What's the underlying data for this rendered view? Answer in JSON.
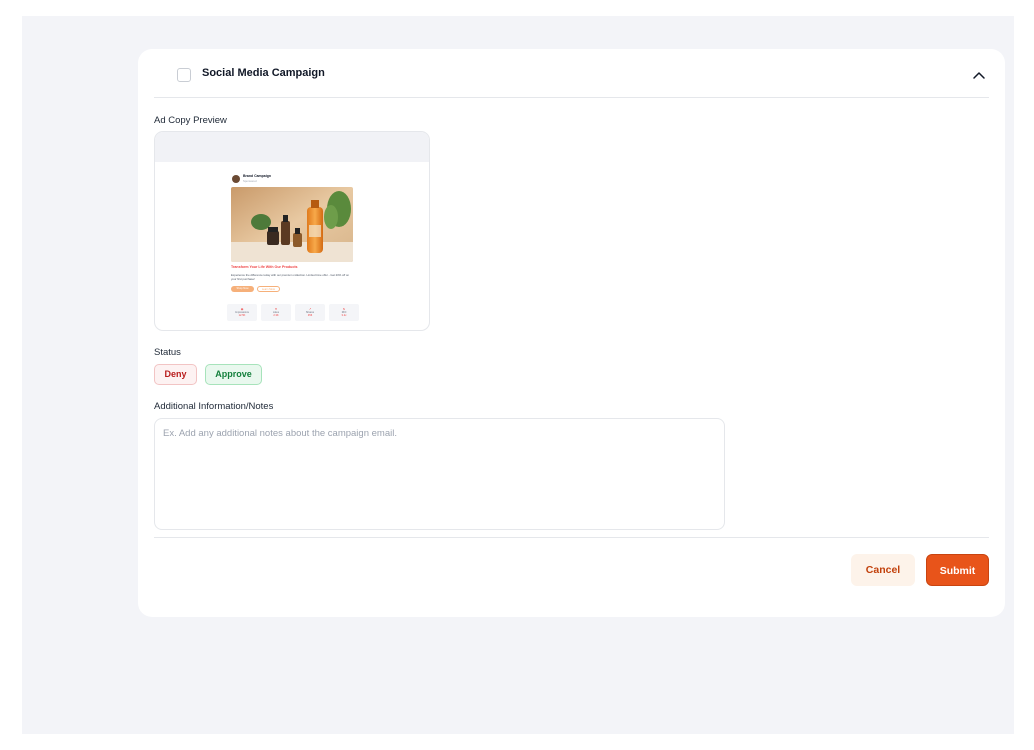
{
  "section": {
    "title": "Social Media Campaign",
    "collapse_icon": "chevron-up-icon"
  },
  "preview": {
    "label": "Ad Copy Preview",
    "post": {
      "brand": "Brand Campaign",
      "sponsored": "Sponsored",
      "headline": "Transform Your Life With Our Products",
      "body": "Experience the difference today with our premium collection. Limited time offer - Get 20% off on your first purchase!",
      "primary_cta": "Shop Now",
      "secondary_cta": "Learn More",
      "stats": [
        {
          "icon": "eye-icon",
          "label": "Impressions",
          "value": "12.5K"
        },
        {
          "icon": "thumb-up-icon",
          "label": "Likes",
          "value": "2.3K"
        },
        {
          "icon": "share-icon",
          "label": "Shares",
          "value": "456"
        },
        {
          "icon": "dollar-icon",
          "label": "ROI",
          "value": "3.2x"
        }
      ]
    }
  },
  "status": {
    "label": "Status",
    "deny_label": "Deny",
    "approve_label": "Approve"
  },
  "notes": {
    "label": "Additional Information/Notes",
    "placeholder": "Ex. Add any additional notes about the campaign email.",
    "value": ""
  },
  "actions": {
    "cancel_label": "Cancel",
    "submit_label": "Submit"
  },
  "colors": {
    "accent": "#e8541a",
    "deny": "#b91c1c",
    "approve": "#15803d"
  }
}
